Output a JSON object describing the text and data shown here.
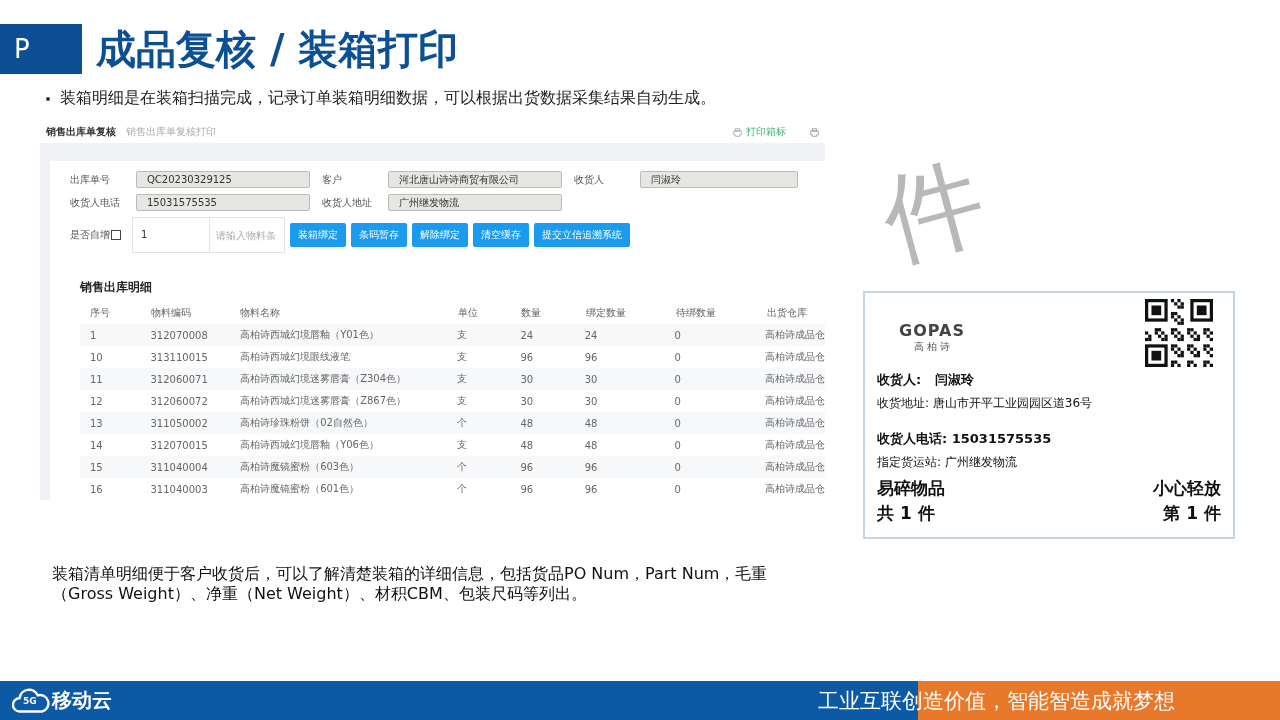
{
  "header": {
    "badge": "P",
    "title": "成品复核 / 装箱打印"
  },
  "bullet": "装箱明细是在装箱扫描完成，记录订单装箱明细数据，可以根据出货数据采集结果自动生成。",
  "app": {
    "page_title": "销售出库单复核",
    "breadcrumb": "销售出库单复核打印",
    "print_action": "打印箱标",
    "fields": [
      {
        "label": "出库单号",
        "value": "QC20230329125"
      },
      {
        "label": "客户",
        "value": "河北唐山诗诗商贸有限公司"
      },
      {
        "label": "收货人",
        "value": "闫淑玲"
      },
      {
        "label": "收货人电话",
        "value": "15031575535"
      },
      {
        "label": "收货人地址",
        "value": "广州继发物流"
      }
    ],
    "auto_increment": {
      "label": "是否自增",
      "checked": false
    },
    "quantity": "1",
    "barcode_placeholder": "请输入物料条",
    "buttons": [
      "装箱绑定",
      "条码暂存",
      "解除绑定",
      "清空缓存",
      "提交立信追溯系统"
    ],
    "table": {
      "title": "销售出库明细",
      "columns": [
        "序号",
        "物料编码",
        "物料名称",
        "单位",
        "数量",
        "绑定数量",
        "待绑数量",
        "出货仓库"
      ],
      "rows": [
        [
          "1",
          "312070008",
          "高柏诗西城幻境唇釉（Y01色）",
          "支",
          "24",
          "24",
          "0",
          "高柏诗成品仓"
        ],
        [
          "10",
          "313110015",
          "高柏诗西城幻境眼线液笔",
          "支",
          "96",
          "96",
          "0",
          "高柏诗成品仓"
        ],
        [
          "11",
          "312060071",
          "高柏诗西城幻境迷雾唇膏（Z304色）",
          "支",
          "30",
          "30",
          "0",
          "高柏诗成品仓"
        ],
        [
          "12",
          "312060072",
          "高柏诗西城幻境迷雾唇膏（Z867色）",
          "支",
          "30",
          "30",
          "0",
          "高柏诗成品仓"
        ],
        [
          "13",
          "311050002",
          "高柏诗珍珠粉饼（02自然色）",
          "个",
          "48",
          "48",
          "0",
          "高柏诗成品仓"
        ],
        [
          "14",
          "312070015",
          "高柏诗西城幻境唇釉（Y06色）",
          "支",
          "48",
          "48",
          "0",
          "高柏诗成品仓"
        ],
        [
          "15",
          "311040004",
          "高柏诗魔镜蜜粉（603色）",
          "个",
          "96",
          "96",
          "0",
          "高柏诗成品仓"
        ],
        [
          "16",
          "311040003",
          "高柏诗魔镜蜜粉（601色）",
          "个",
          "96",
          "96",
          "0",
          "高柏诗成品仓"
        ]
      ]
    }
  },
  "side_char": "件",
  "shipping_label": {
    "brand": "GOPAS",
    "brand_cn": "高 柏 诗",
    "recipient_label": "收货人:",
    "recipient": "闫淑玲",
    "address": "收货地址: 唐山市开平工业园园区道36号",
    "phone": "收货人电话: 15031575535",
    "station": "指定货运站: 广州继发物流",
    "fragile": "易碎物品",
    "handle_care": "小心轻放",
    "total": "共 1 件",
    "index": "第 1 件"
  },
  "caption": "装箱清单明细便于客户收货后，可以了解清楚装箱的详细信息，包括货品PO Num，Part Num，毛重（Gross Weight）、净重（Net Weight）、材积CBM、包装尺码等列出。",
  "footer": {
    "logo_badge": "5G",
    "logo_text": "移动云",
    "slogan": "工业互联创造价值，智能智造成就梦想"
  }
}
